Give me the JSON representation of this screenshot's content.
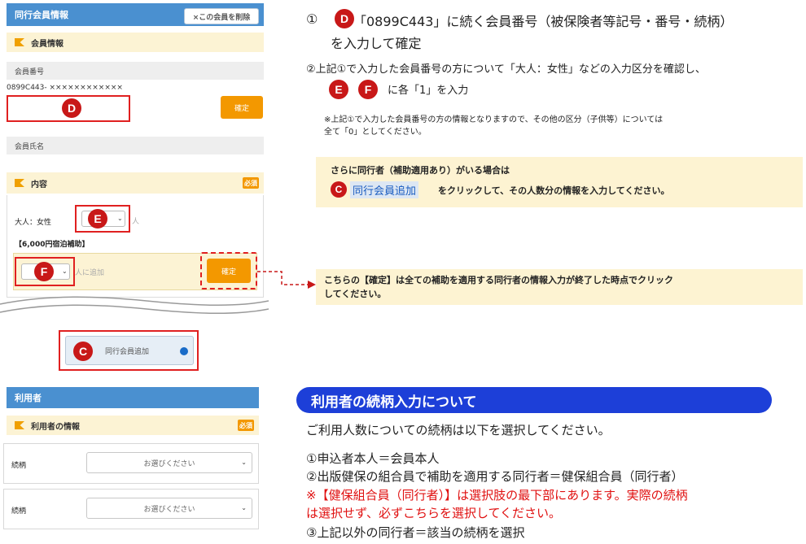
{
  "companion_panel": {
    "title": "同行会員情報",
    "delete_button": "×この会員を削除",
    "member_info_section": "会員情報",
    "member_number_label": "会員番号",
    "member_number_prefix": "0899C443- ××××××××××××",
    "confirm_button": "確定",
    "member_name_label": "会員氏名",
    "content_section": "内容",
    "required_badge": "必須",
    "adult_female_label": "大人：女性",
    "unit_person": "人",
    "subsidy_label": "【6,000円宿泊補助】",
    "add_people_text": "人に追加",
    "subsidy_confirm_button": "確定",
    "add_companion_button": "同行会員追加"
  },
  "user_panel": {
    "title": "利用者",
    "user_info_section": "利用者の情報",
    "required_badge": "必須",
    "rows": [
      {
        "label": "続柄",
        "placeholder": "お選びください"
      },
      {
        "label": "続柄",
        "placeholder": "お選びください"
      }
    ]
  },
  "badges": {
    "d": "D",
    "e": "E",
    "f": "F",
    "c": "C"
  },
  "instructions": {
    "step1_num": "①",
    "step1_line1": "「0899C443」に続く会員番号（被保険者等記号・番号・続柄）",
    "step1_line2": "を入力して確定",
    "step2_line1": "②上記①で入力した会員番号の方について「大人：女性」などの入力区分を確認し、",
    "step2_line2": "に各「1」を入力",
    "step2_note_line1": "※上記①で入力した会員番号の方の情報となりますので、その他の区分（子供等）については",
    "step2_note_line2": "全て「0」としてください。",
    "companion_box_title": "さらに同行者（補助適用あり）がいる場合は",
    "companion_box_link": "同行会員追加",
    "companion_box_text": "をクリックして、その人数分の情報を入力してください。",
    "confirm_note_line1": "こちらの【確定】は全ての補助を適用する同行者の情報入力が終了した時点でクリック",
    "confirm_note_line2": "してください。"
  },
  "relation_section": {
    "heading": "利用者の続柄入力について",
    "intro": "ご利用人数についての続柄は以下を選択してください。",
    "item1": "①申込者本人＝会員本人",
    "item2": "②出版健保の組合員で補助を適用する同行者＝健保組合員（同行者）",
    "warning_line1": "※【健保組合員（同行者）】は選択肢の最下部にあります。実際の続柄",
    "warning_line2": "は選択せず、必ずこちらを選択してください。",
    "item3": "③上記以外の同行者＝該当の続柄を選択"
  },
  "colors": {
    "accent_blue": "#4a90d0",
    "badge_red": "#c81818",
    "button_orange": "#f39800",
    "pill_blue": "#1d3fd8",
    "warning_red": "#e01010"
  }
}
